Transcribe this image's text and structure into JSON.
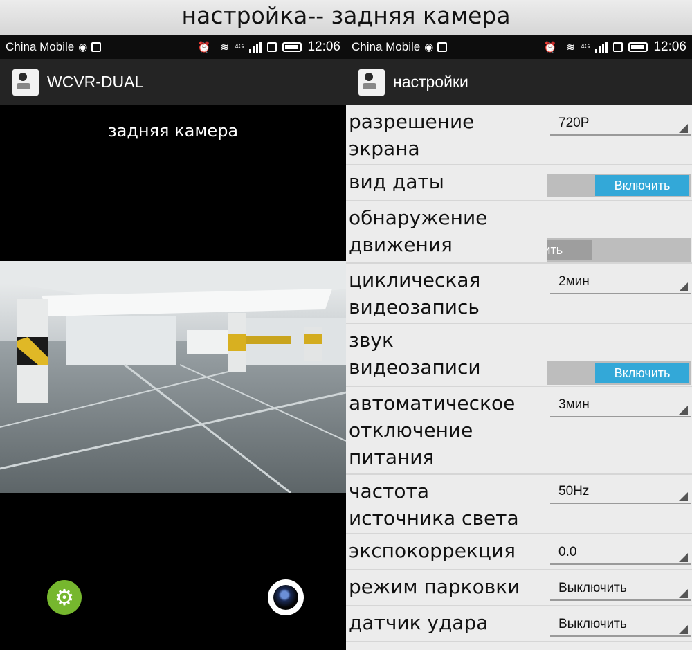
{
  "banner": {
    "title": "настройка-- задняя камера"
  },
  "status_bar": {
    "carrier": "China Mobile",
    "network": "4G",
    "time": "12:06"
  },
  "left_screen": {
    "app_title": "WCVR-DUAL",
    "camera_label": "задняя камера",
    "icons": {
      "settings": "gear-icon",
      "capture": "camera-lens-icon"
    },
    "colors": {
      "settings_button": "#76b72e"
    }
  },
  "right_screen": {
    "app_title": "настройки",
    "colors": {
      "toggle_on": "#33a8d8"
    },
    "settings": [
      {
        "label": "разрешение\nэкрана",
        "type": "select",
        "value": "720P"
      },
      {
        "label": "вид даты",
        "type": "toggle",
        "value": "Включить"
      },
      {
        "label": "обнаружение\nдвижения",
        "type": "toggle-off",
        "value": "ючить"
      },
      {
        "label": "циклическая\nвидеозапись",
        "type": "select",
        "value": "2мин"
      },
      {
        "label": "звук\nвидеозаписи",
        "type": "toggle",
        "value": "Включить"
      },
      {
        "label": "автоматическое\nотключение\nпитания",
        "type": "select",
        "value": "3мин"
      },
      {
        "label": "частота\nисточника света",
        "type": "select",
        "value": "50Hz"
      },
      {
        "label": "экспокоррекция",
        "type": "select",
        "value": "0.0"
      },
      {
        "label": "режим парковки",
        "type": "select",
        "value": "Выключить"
      },
      {
        "label": "датчик удара",
        "type": "select",
        "value": "Выключить"
      }
    ]
  }
}
